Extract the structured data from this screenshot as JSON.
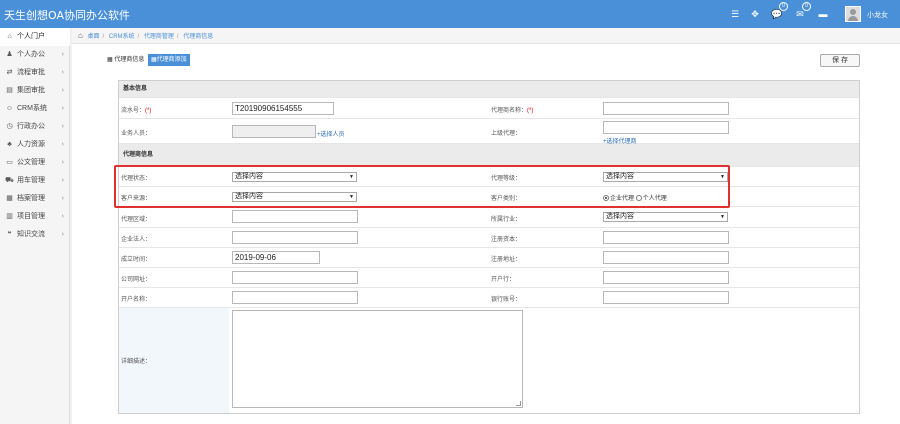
{
  "app": {
    "title": "天生创想OA协同办公软件",
    "username": "小龙女",
    "badges": {
      "chat": "0",
      "messages": "0"
    }
  },
  "sidebar": {
    "items": [
      {
        "label": "个人门户",
        "icon": "home-icon",
        "active": true
      },
      {
        "label": "个人办公",
        "icon": "user-icon"
      },
      {
        "label": "流程审批",
        "icon": "flow-icon"
      },
      {
        "label": "集团审批",
        "icon": "building-icon"
      },
      {
        "label": "CRM系统",
        "icon": "group-icon"
      },
      {
        "label": "行政办公",
        "icon": "clock-icon"
      },
      {
        "label": "人力资源",
        "icon": "sitemap-icon"
      },
      {
        "label": "公文管理",
        "icon": "folder-icon"
      },
      {
        "label": "用车管理",
        "icon": "car-icon"
      },
      {
        "label": "档案管理",
        "icon": "archive-icon"
      },
      {
        "label": "项目管理",
        "icon": "project-icon"
      },
      {
        "label": "知识交流",
        "icon": "chat-icon"
      }
    ]
  },
  "breadcrumb": [
    "桌面",
    "CRM系统",
    "代理商管理",
    "代理商信息"
  ],
  "tabs": {
    "info": "代理商信息",
    "add": "代理商添加"
  },
  "toolbar": {
    "save_label": "保 存"
  },
  "form": {
    "section_basic": "基本信息",
    "section_agent": "代理商信息",
    "serial_label": "流水号：",
    "serial_value": "T20190906154555",
    "agent_name_label": "代理商名称：",
    "required_mark": "(*)",
    "staff_label": "业务人员：",
    "select_staff_link": "+选择人员",
    "parent_label": "上级代理：",
    "select_agent_link": "+选择代理商",
    "status_label": "代理状态：",
    "level_label": "代理等级：",
    "source_label": "客户来源：",
    "category_label": "客户类别：",
    "select_placeholder": "选择内容",
    "radio_enterprise": "企业代理",
    "radio_personal": "个人代理",
    "region_label": "代理区域：",
    "industry_label": "所属行业：",
    "legal_label": "企业法人：",
    "capital_label": "注册资本：",
    "established_label": "成立时间：",
    "established_value": "2019-09-06",
    "address_label": "注册地址：",
    "website_label": "公司网址：",
    "bank_label": "开户行：",
    "account_name_label": "开户名称：",
    "account_no_label": "银行账号：",
    "detail_label": "详细描述："
  },
  "colors": {
    "accent": "#4a90d9",
    "highlight": "#e03030"
  }
}
